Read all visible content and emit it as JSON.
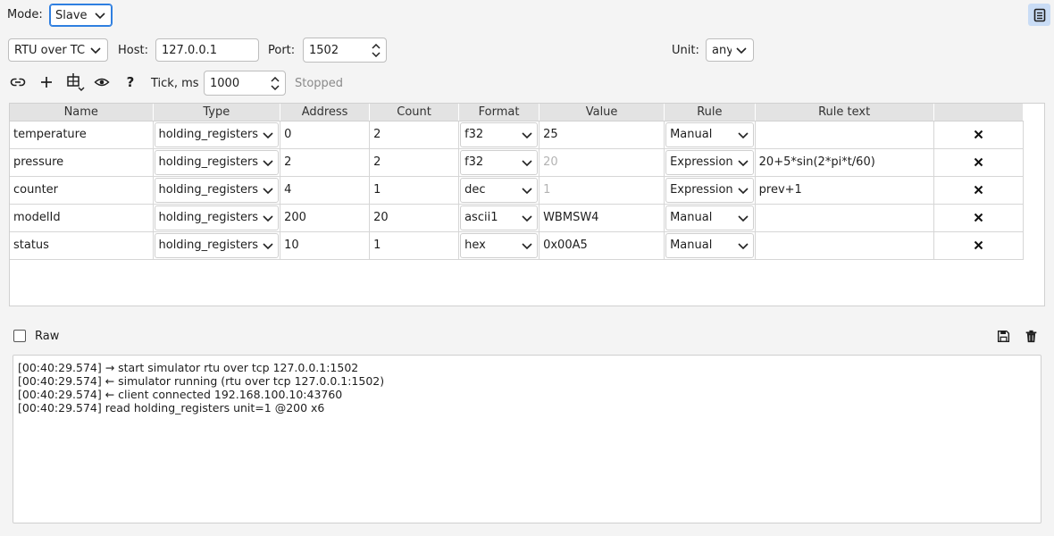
{
  "mode": {
    "label": "Mode:",
    "value": "Slave"
  },
  "connection": {
    "transport": "RTU over TCP",
    "host_label": "Host:",
    "host": "127.0.0.1",
    "port_label": "Port:",
    "port": "1502",
    "unit_label": "Unit:",
    "unit": "any"
  },
  "toolbar": {
    "icons": [
      "link-icon",
      "plus-icon",
      "table-add-icon",
      "eye-icon",
      "help-icon"
    ],
    "help_label": "?",
    "tick_label": "Tick, ms",
    "tick": "1000",
    "status": "Stopped"
  },
  "table": {
    "columns": [
      "Name",
      "Type",
      "Address",
      "Count",
      "Format",
      "Value",
      "Rule",
      "Rule text",
      ""
    ],
    "rows": [
      {
        "name": "temperature",
        "type": "holding_registers",
        "address": "0",
        "count": "2",
        "format": "f32",
        "value": "25",
        "value_placeholder": "",
        "rule": "Manual",
        "rule_text": ""
      },
      {
        "name": "pressure",
        "type": "holding_registers",
        "address": "2",
        "count": "2",
        "format": "f32",
        "value": "",
        "value_placeholder": "20",
        "rule": "Expression",
        "rule_text": "20+5*sin(2*pi*t/60)"
      },
      {
        "name": "counter",
        "type": "holding_registers",
        "address": "4",
        "count": "1",
        "format": "dec",
        "value": "",
        "value_placeholder": "1",
        "rule": "Expression",
        "rule_text": "prev+1"
      },
      {
        "name": "modelId",
        "type": "holding_registers",
        "address": "200",
        "count": "20",
        "format": "ascii1",
        "value": "WBMSW4",
        "value_placeholder": "",
        "rule": "Manual",
        "rule_text": ""
      },
      {
        "name": "status",
        "type": "holding_registers",
        "address": "10",
        "count": "1",
        "format": "hex",
        "value": "0x00A5",
        "value_placeholder": "",
        "rule": "Manual",
        "rule_text": ""
      }
    ]
  },
  "log": {
    "raw_label": "Raw",
    "raw_checked": false,
    "lines": [
      "[00:40:29.574] → start simulator rtu over tcp 127.0.0.1:1502",
      "[00:40:29.574] ← simulator running (rtu over tcp 127.0.0.1:1502)",
      "[00:40:29.574] ← client connected 192.168.100.10:43760",
      "[00:40:29.574] read holding_registers unit=1 @200 x6"
    ]
  },
  "colors": {
    "accent": "#2f7fe0",
    "header_bg": "#e3e3e3",
    "toggle_bg": "#c9dcf5"
  }
}
